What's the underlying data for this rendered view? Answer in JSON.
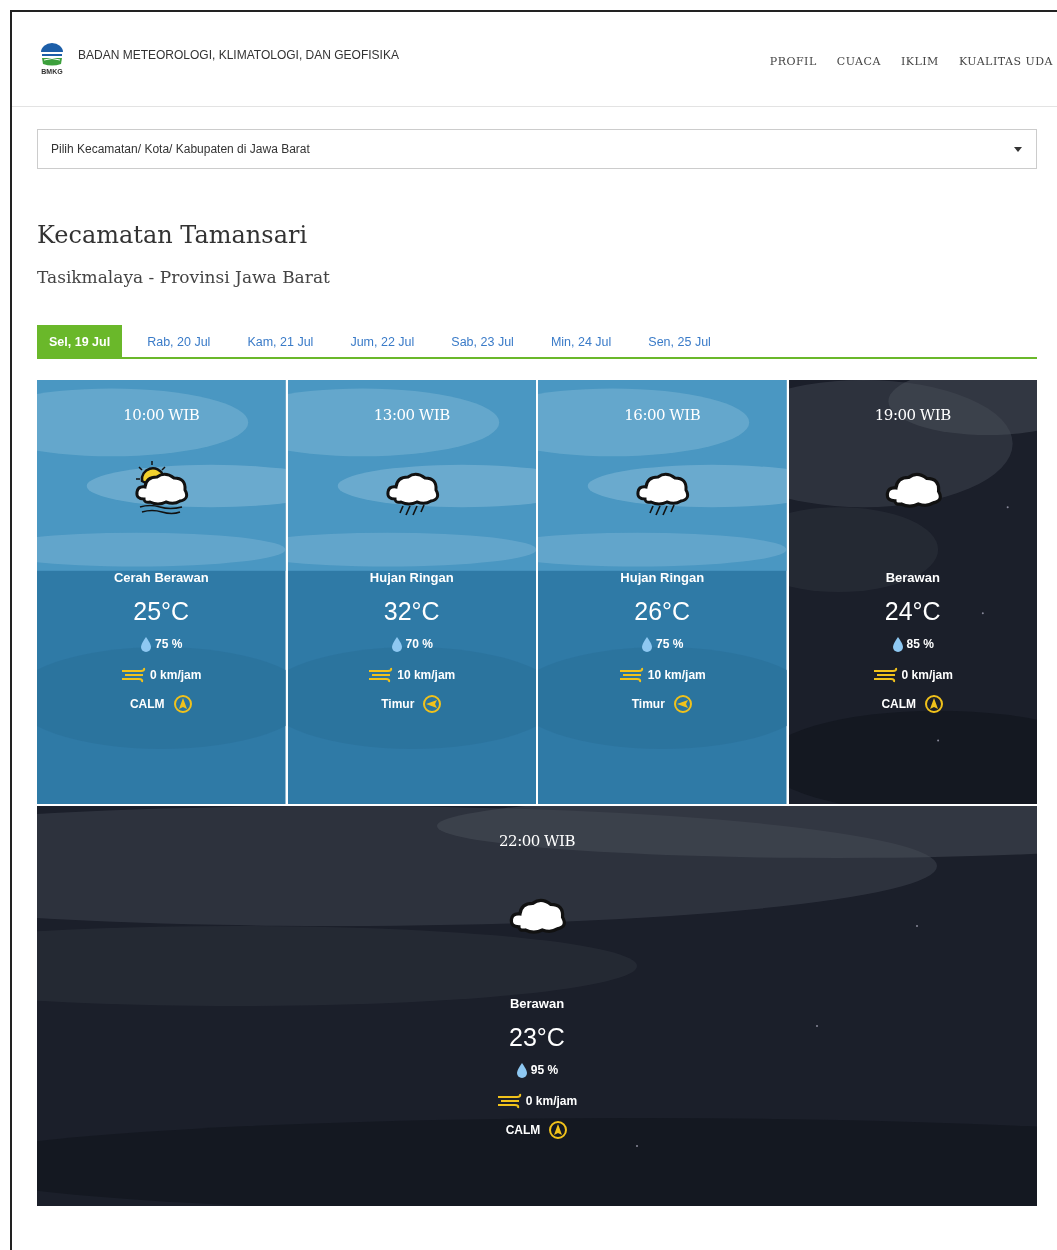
{
  "header": {
    "logo_text": "BMKG",
    "agency": "BADAN METEOROLOGI, KLIMATOLOGI, DAN GEOFISIKA",
    "nav": [
      "PROFIL",
      "CUACA",
      "IKLIM",
      "KUALITAS UDA"
    ]
  },
  "location_select": {
    "placeholder": "Pilih Kecamatan/ Kota/ Kabupaten di Jawa Barat"
  },
  "title": "Kecamatan Tamansari",
  "subtitle": "Tasikmalaya - Provinsi Jawa Barat",
  "tabs": [
    {
      "label": "Sel, 19 Jul",
      "selected": true
    },
    {
      "label": "Rab, 20 Jul",
      "selected": false
    },
    {
      "label": "Kam, 21 Jul",
      "selected": false
    },
    {
      "label": "Jum, 22 Jul",
      "selected": false
    },
    {
      "label": "Sab, 23 Jul",
      "selected": false
    },
    {
      "label": "Min, 24 Jul",
      "selected": false
    },
    {
      "label": "Sen, 25 Jul",
      "selected": false
    }
  ],
  "forecasts": [
    {
      "kind": "day",
      "time": "10:00 WIB",
      "weather_icon": {
        "kind": "sunny"
      },
      "condition": "Cerah Berawan",
      "temperature": "25°C",
      "humidity": "75 %",
      "wind_speed": "0 km/jam",
      "wind_direction": "CALM",
      "direction_icon": {
        "kind": "north"
      }
    },
    {
      "kind": "day",
      "time": "13:00 WIB",
      "weather_icon": {
        "kind": "rain"
      },
      "condition": "Hujan Ringan",
      "temperature": "32°C",
      "humidity": "70 %",
      "wind_speed": "10 km/jam",
      "wind_direction": "Timur",
      "direction_icon": {
        "kind": "west"
      }
    },
    {
      "kind": "day",
      "time": "16:00 WIB",
      "weather_icon": {
        "kind": "rain"
      },
      "condition": "Hujan Ringan",
      "temperature": "26°C",
      "humidity": "75 %",
      "wind_speed": "10 km/jam",
      "wind_direction": "Timur",
      "direction_icon": {
        "kind": "west"
      }
    },
    {
      "kind": "night",
      "time": "19:00 WIB",
      "weather_icon": {
        "kind": "cloud"
      },
      "condition": "Berawan",
      "temperature": "24°C",
      "humidity": "85 %",
      "wind_speed": "0 km/jam",
      "wind_direction": "CALM",
      "direction_icon": {
        "kind": "north"
      }
    },
    {
      "kind": "night",
      "time": "22:00 WIB",
      "weather_icon": {
        "kind": "cloud"
      },
      "condition": "Berawan",
      "temperature": "23°C",
      "humidity": "95 %",
      "wind_speed": "0 km/jam",
      "wind_direction": "CALM",
      "direction_icon": {
        "kind": "north"
      }
    }
  ]
}
